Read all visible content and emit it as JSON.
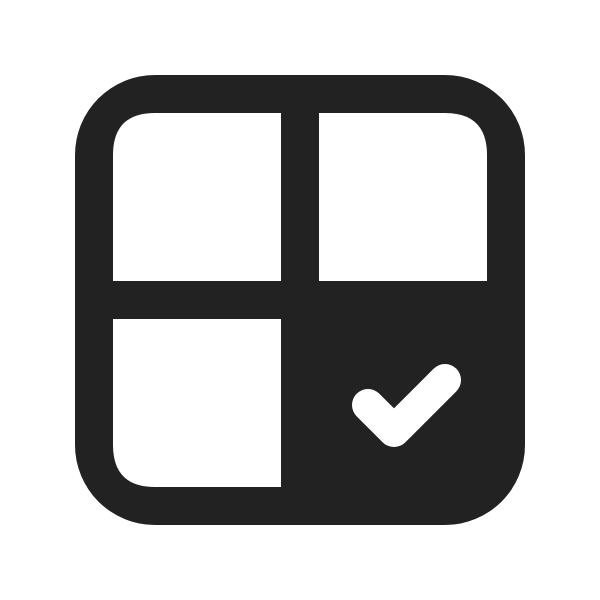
{
  "icon": {
    "name": "grid-checkmark-icon",
    "color": "#222222",
    "background": "#ffffff",
    "checked_cell": "bottom-right"
  }
}
